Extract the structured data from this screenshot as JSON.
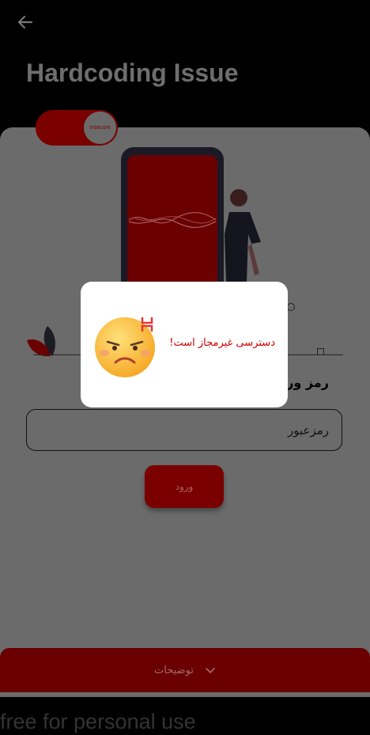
{
  "header": {
    "title": "Hardcoding Issue"
  },
  "toggle": {
    "label": "insecure"
  },
  "form": {
    "section_label": "رمز ورود",
    "password_placeholder": "رمزعبور",
    "login_label": "ورود"
  },
  "bottom_bar": {
    "label": "توضیحات"
  },
  "watermark": "free for personal use",
  "dialog": {
    "message": "دسترسی غیرمجاز است!",
    "icon": "angry-face-icon"
  },
  "colors": {
    "accent": "#7a0000",
    "dialog_text": "#cc0000",
    "overlay": "#6b6b6b"
  }
}
